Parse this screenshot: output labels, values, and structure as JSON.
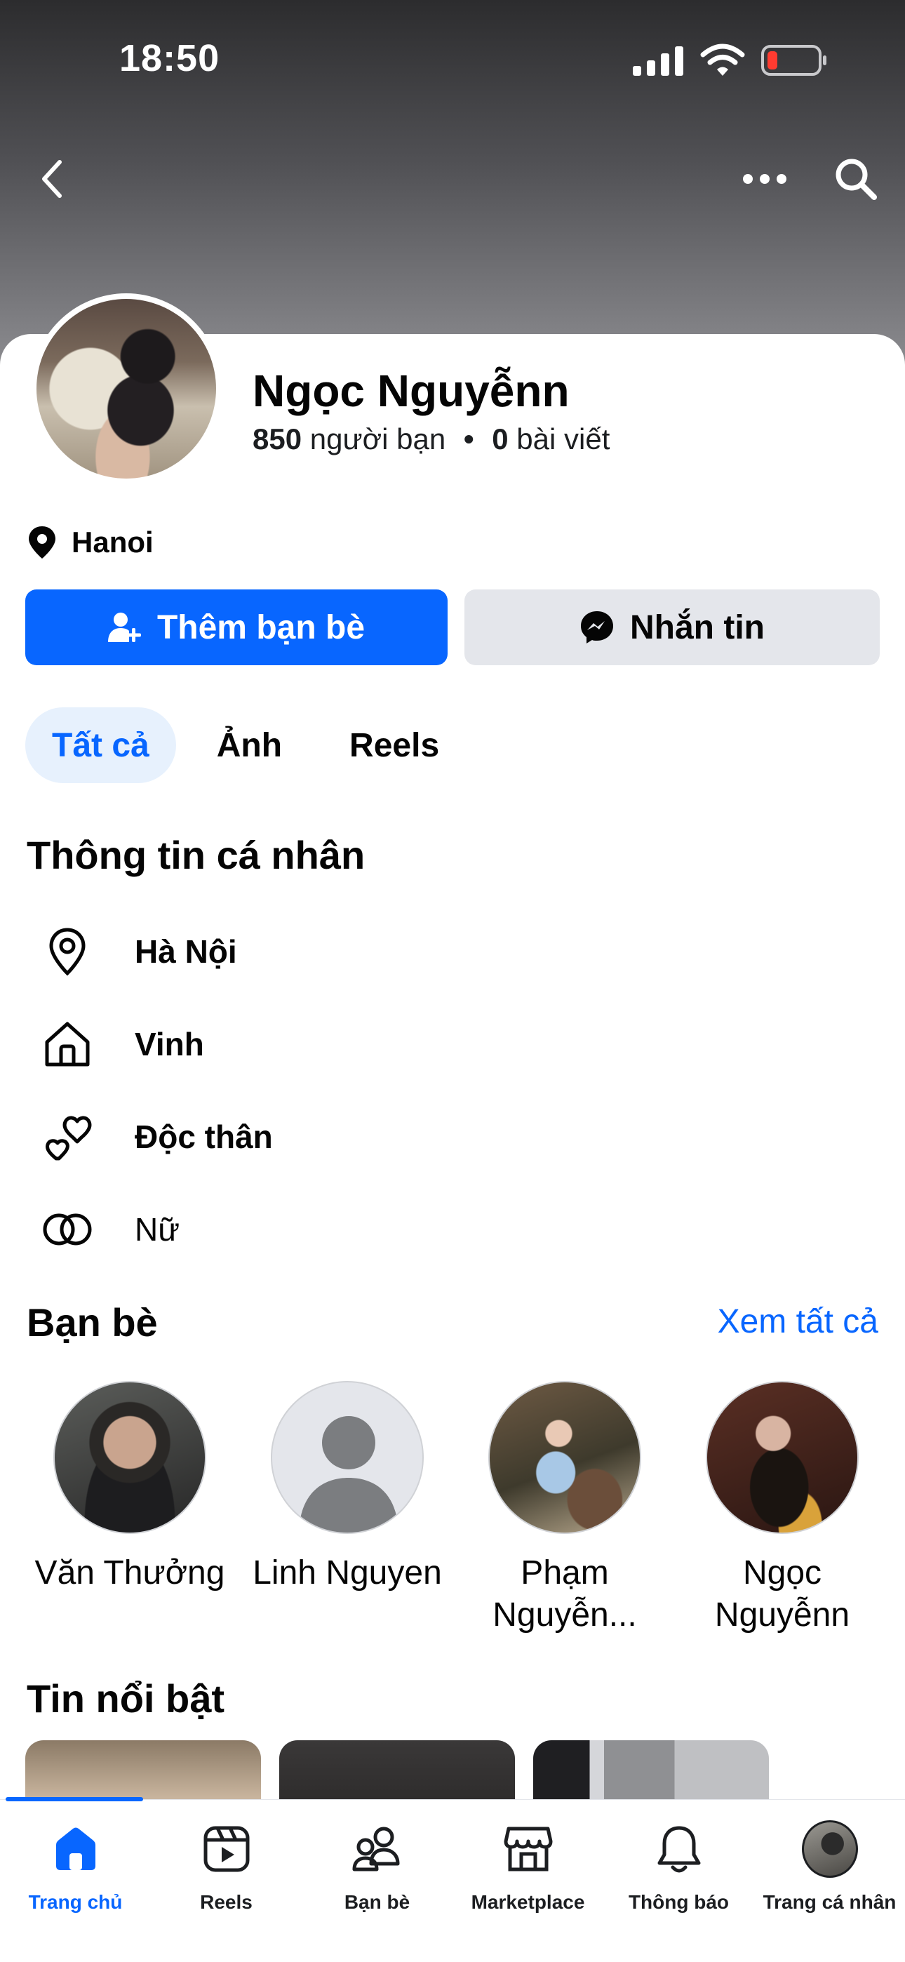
{
  "status_bar": {
    "time": "18:50"
  },
  "profile": {
    "name": "Ngọc Nguyễnn",
    "friends_count": "850",
    "friends_label": "người bạn",
    "separator": "•",
    "posts_count": "0",
    "posts_label": "bài viết",
    "location": "Hanoi"
  },
  "actions": {
    "add_friend": "Thêm bạn bè",
    "message": "Nhắn tin"
  },
  "tabs": [
    {
      "label": "Tất cả",
      "active": true
    },
    {
      "label": "Ảnh",
      "active": false
    },
    {
      "label": "Reels",
      "active": false
    }
  ],
  "personal_info": {
    "title": "Thông tin cá nhân",
    "items": [
      {
        "icon": "location-pin-icon",
        "label": "Hà Nội"
      },
      {
        "icon": "home-icon",
        "label": "Vinh"
      },
      {
        "icon": "hearts-icon",
        "label": "Độc thân"
      },
      {
        "icon": "gender-rings-icon",
        "label": "Nữ"
      }
    ]
  },
  "friends": {
    "title": "Bạn bè",
    "see_all": "Xem tất cả",
    "items": [
      {
        "name": "Văn Thưởng"
      },
      {
        "name": "Linh Nguyen"
      },
      {
        "name": "Phạm Nguyễn..."
      },
      {
        "name": "Ngọc Nguyễnn"
      }
    ]
  },
  "highlights": {
    "title": "Tin nổi bật"
  },
  "tabbar": {
    "items": [
      {
        "label": "Trang chủ",
        "icon": "home-filled-icon",
        "active": true
      },
      {
        "label": "Reels",
        "icon": "reels-icon",
        "active": false
      },
      {
        "label": "Bạn bè",
        "icon": "friends-icon",
        "active": false
      },
      {
        "label": "Marketplace",
        "icon": "marketplace-icon",
        "active": false
      },
      {
        "label": "Thông báo",
        "icon": "bell-icon",
        "active": false
      },
      {
        "label": "Trang cá nhân",
        "icon": "profile-avatar",
        "active": false
      }
    ]
  },
  "colors": {
    "accent": "#0866ff",
    "secondary_button": "#e4e6eb",
    "active_tab_bg": "#e7f1fd"
  }
}
